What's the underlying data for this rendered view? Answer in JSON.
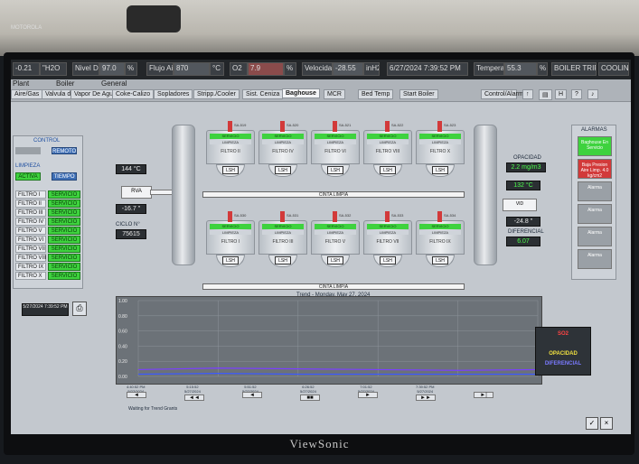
{
  "brand": "ViewSonic",
  "wall_label": "MOTOROLA",
  "topbar": {
    "cells": [
      "-0.21",
      "\"H2O",
      "Nivel De Cal/Flujo",
      "97.0",
      "%",
      "Flujo Aire",
      "870",
      "°C",
      "O2",
      "7.9",
      "%",
      "Velocidad ventilador",
      "-28.55",
      "inH2",
      "6/27/2024 7:39:52 PM",
      "Temperatura Caldera",
      "55.3",
      "%",
      "BOILER TRIPPED",
      "COOLING FAN"
    ]
  },
  "nav": {
    "top_tabs": [
      "Plant",
      "Boiler",
      "General"
    ],
    "tabs": [
      "Aire/Gas",
      "Valvula d",
      "Vapor De Agua",
      "Coke-Calizo",
      "Sopladores",
      "Stripp./Cooler",
      "Sist. Ceniza",
      "Baghouse",
      "MCR",
      "Bed Temp",
      "Start Boiler"
    ],
    "active_tab": "Baghouse",
    "controls_label": "Control/Alarm"
  },
  "control": {
    "title": "CONTROL",
    "mode_value": "",
    "remoto_label": "REMOTO",
    "limpieza_title": "LIMPIEZA",
    "activa_label": "ACTIVA",
    "tiempo_label": "TIEMPO"
  },
  "filter_table": [
    {
      "name": "FILTRO I",
      "status": "SERVICIO"
    },
    {
      "name": "FILTRO II",
      "status": "SERVICIO"
    },
    {
      "name": "FILTRO III",
      "status": "SERVICIO"
    },
    {
      "name": "FILTRO IV",
      "status": "SERVICIO"
    },
    {
      "name": "FILTRO V",
      "status": "SERVICIO"
    },
    {
      "name": "FILTRO VI",
      "status": "SERVICIO"
    },
    {
      "name": "FILTRO VII",
      "status": "SERVICIO"
    },
    {
      "name": "FILTRO VIII",
      "status": "SERVICIO"
    },
    {
      "name": "FILTRO IX",
      "status": "SERVICIO"
    },
    {
      "name": "FILTRO X",
      "status": "SERVICIO"
    }
  ],
  "timestamp_box": "5/27/2024 7:39:52 PM",
  "process": {
    "inlet_temp": "144 °C",
    "rva_label": "RVA",
    "inlet_value": "-16.7 \"",
    "ciclo_label": "CICLO N°",
    "ciclo_value": "75615",
    "opacidad_label": "OPACIDAD",
    "opacidad_value": "2.2 mg/m3",
    "outlet_temp": "132 °C",
    "outlet_box": "-24.8 \"",
    "diferencial_label": "DIFERENCIAL",
    "diferencial_value": "6.07",
    "conveyor_label": "CINTA LIMPIA",
    "salida_box": "VID",
    "note": "Trend - Monday, May 27, 2024"
  },
  "filters_top": [
    {
      "name": "FILTRO II",
      "tag": "SA-519",
      "status": "SERVICIO",
      "limp": "LIMPIEZA",
      "lsh": "LSH"
    },
    {
      "name": "FILTRO IV",
      "tag": "SA-520",
      "status": "SERVICIO",
      "limp": "LIMPIEZA",
      "lsh": "LSH"
    },
    {
      "name": "FILTRO VI",
      "tag": "SA-521",
      "status": "SERVICIO",
      "limp": "LIMPIEZA",
      "lsh": "LSH"
    },
    {
      "name": "FILTRO VIII",
      "tag": "SA-522",
      "status": "SERVICIO",
      "limp": "LIMPIEZA",
      "lsh": "LSH"
    },
    {
      "name": "FILTRO X",
      "tag": "SA-523",
      "status": "SERVICIO",
      "limp": "LIMPIEZA",
      "lsh": "LSH"
    }
  ],
  "filters_bottom": [
    {
      "name": "FILTRO I",
      "tag": "SA-530",
      "status": "SERVICIO",
      "limp": "LIMPIEZA",
      "lsh": "LSH"
    },
    {
      "name": "FILTRO III",
      "tag": "SA-531",
      "status": "SERVICIO",
      "limp": "LIMPIEZA",
      "lsh": "LSH"
    },
    {
      "name": "FILTRO V",
      "tag": "SA-532",
      "status": "SERVICIO",
      "limp": "LIMPIEZA",
      "lsh": "LSH"
    },
    {
      "name": "FILTRO VII",
      "tag": "SA-533",
      "status": "SERVICIO",
      "limp": "LIMPIEZA",
      "lsh": "LSH"
    },
    {
      "name": "FILTRO IX",
      "tag": "SA-534",
      "status": "SERVICIO",
      "limp": "LIMPIEZA",
      "lsh": "LSH"
    }
  ],
  "alarms": {
    "title": "ALARMAS",
    "items": [
      {
        "text": "Baghouse En Servicio",
        "color": "#3ed23e"
      },
      {
        "text": "Baja Presion Aire Limp. 4.0 kg/cm2",
        "color": "#d23a3a"
      },
      {
        "text": "Alarma",
        "color": "#9aa0a6"
      },
      {
        "text": "Alarma",
        "color": "#9aa0a6"
      },
      {
        "text": "Alarma",
        "color": "#9aa0a6"
      },
      {
        "text": "Alarma",
        "color": "#9aa0a6"
      }
    ]
  },
  "trend": {
    "legend": [
      "SO2",
      "",
      "OPACIDAD",
      "DIFERENCIAL"
    ],
    "legend_colors": [
      "#ff4444",
      "#ffffff",
      "#f0e040",
      "#7a7aff"
    ],
    "y_ticks": [
      "1.00",
      "0.80",
      "0.60",
      "0.40",
      "0.20",
      "0.00"
    ],
    "x_ticks": [
      "4:40:52 PM\n5/27/2024",
      "5:15:52\n5/27/2024",
      "5:51:52\n5/27/2024",
      "6:26:52\n5/27/2024",
      "7:01:52\n5/27/2024",
      "7:39:52 PM\n5/27/2024"
    ],
    "status": "Waiting for Trend Grants"
  },
  "chart_data": {
    "type": "line",
    "x": [
      "4:40:52 PM",
      "5:15:52",
      "5:51:52",
      "6:26:52",
      "7:01:52",
      "7:39:52 PM"
    ],
    "series": [
      {
        "name": "OPACIDAD",
        "values": [
          0.09,
          0.11,
          0.1,
          0.09,
          0.08,
          0.09
        ]
      },
      {
        "name": "DIFERENCIAL",
        "values": [
          0.03,
          0.04,
          0.03,
          0.03,
          0.03,
          0.03
        ]
      }
    ],
    "ylim": [
      0,
      1
    ]
  }
}
